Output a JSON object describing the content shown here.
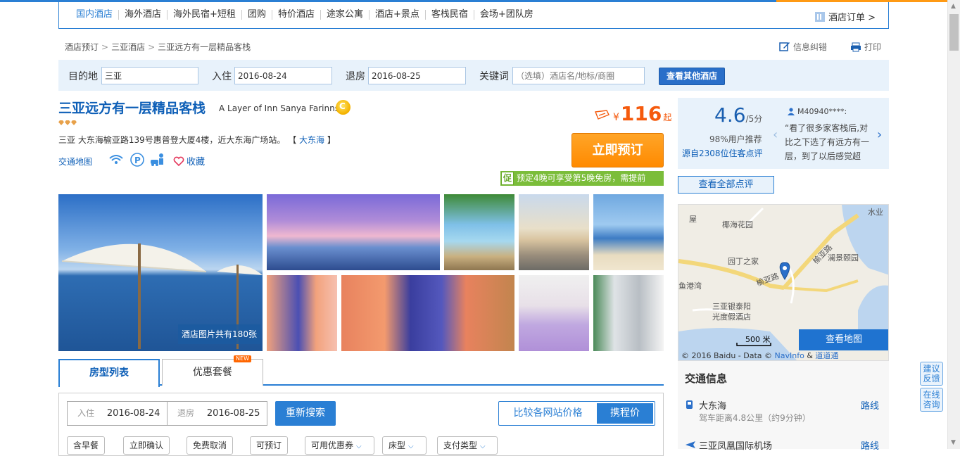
{
  "nav": {
    "items": [
      "国内酒店",
      "海外酒店",
      "海外民宿+短租",
      "团购",
      "特价酒店",
      "途家公寓",
      "酒店+景点",
      "客栈民宿",
      "会场+团队房"
    ],
    "orders": "酒店订单 >"
  },
  "breadcrumb": [
    "酒店预订",
    "三亚酒店",
    "三亚远方有一层精品客栈"
  ],
  "tools": {
    "correct": "信息纠错",
    "print": "打印"
  },
  "search": {
    "dest_label": "目的地",
    "dest_value": "三亚",
    "checkin_label": "入住",
    "checkin_value": "2016-08-24",
    "checkout_label": "退房",
    "checkout_value": "2016-08-25",
    "keyword_label": "关键词",
    "keyword_placeholder": "（选填）酒店名/地标/商圈",
    "button": "查看其他酒店"
  },
  "hotel": {
    "name": "三亚远方有一层精品客栈",
    "name_en": "A Layer of Inn Sanya Farinns",
    "address": "三亚 大东海榆亚路139号惠普登大厦4楼，近大东海广场站。",
    "area_link": "大东海",
    "traffic_map": "交通地图",
    "favorite": "收藏",
    "price_currency": "¥",
    "price": "116",
    "price_suffix": "起",
    "book": "立即预订",
    "promo_tag": "促",
    "promo_text": "预定4晚可享受第5晚免房，需提前",
    "photo_count": "酒店图片共有180张"
  },
  "tabs": {
    "rooms": "房型列表",
    "packages": "优惠套餐",
    "new_badge": "NEW"
  },
  "room_filter": {
    "checkin_label": "入住",
    "checkin_value": "2016-08-24",
    "checkout_label": "退房",
    "checkout_value": "2016-08-25",
    "search_again": "重新搜索",
    "compare": "比较各网站价格",
    "ctrip_price": "携程价",
    "chips": [
      "含早餐",
      "立即确认",
      "免费取消",
      "可预订",
      "可用优惠券",
      "床型",
      "支付类型"
    ]
  },
  "rating": {
    "score": "4.6",
    "out_of": "/5分",
    "recommend": "98%用户推荐",
    "source": "源自2308位住客点评",
    "reviewer": "M40940****:",
    "review": "“看了很多家客栈后,对比之下选了有远方有一层，到了以后感觉超",
    "all": "查看全部点评"
  },
  "map": {
    "labels": [
      "椰海花园",
      "园丁之家",
      "澜景颐园",
      "三亚银泰阳",
      "光度假酒店",
      "榆亚路",
      "榆亚路",
      "鱼港湾",
      "屋",
      "水业"
    ],
    "scale": "500 米",
    "view": "查看地图",
    "copyright": "© 2016 Baidu - Data © ",
    "navinfo": "NavInfo",
    "amp": " & ",
    "citylink": "道道通"
  },
  "traffic": {
    "title": "交通信息",
    "rows": [
      {
        "name": "大东海",
        "sub": "驾车距离4.8公里（约9分钟）",
        "route": "路线"
      },
      {
        "name": "三亚凤凰国际机场",
        "sub": "",
        "route": "路线"
      }
    ]
  },
  "side": {
    "feedback": "建议反馈",
    "chat": "在线咨询"
  },
  "colors": {
    "brand_blue": "#2a7fd4",
    "price_orange": "#f55a0d",
    "book_orange": "#ff9a14",
    "promo_green": "#7bbd3a"
  }
}
